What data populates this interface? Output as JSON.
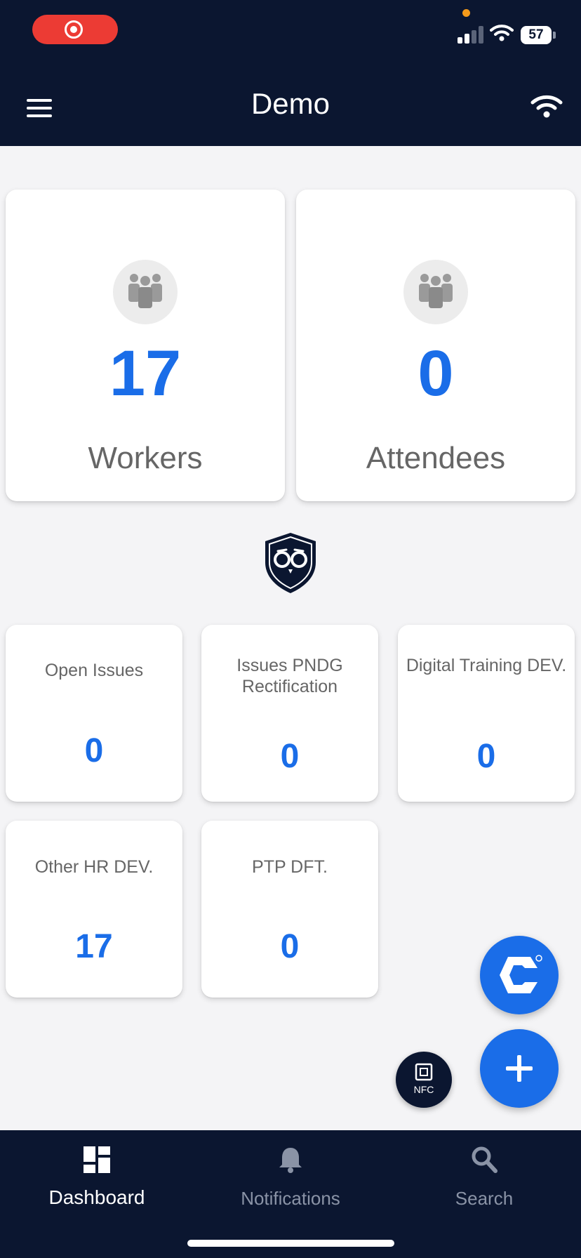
{
  "header": {
    "title": "Demo",
    "battery": "57"
  },
  "stats": [
    {
      "count": "17",
      "label": "Workers"
    },
    {
      "count": "0",
      "label": "Attendees"
    }
  ],
  "tiles": [
    {
      "label": "Open Issues",
      "value": "0"
    },
    {
      "label": "Issues PNDG Rectification",
      "value": "0"
    },
    {
      "label": "Digital Training DEV.",
      "value": "0"
    },
    {
      "label": "Other HR DEV.",
      "value": "17"
    },
    {
      "label": "PTP DFT.",
      "value": "0"
    }
  ],
  "nfc_label": "NFC",
  "nav": [
    {
      "label": "Dashboard",
      "icon": "dashboard-icon",
      "active": true
    },
    {
      "label": "Notifications",
      "icon": "bell-icon",
      "active": false
    },
    {
      "label": "Search",
      "icon": "search-icon",
      "active": false
    }
  ],
  "colors": {
    "header_bg": "#0b1630",
    "accent": "#1a6de8",
    "record": "#ec3b34",
    "nav_inactive": "#8a93a6"
  }
}
